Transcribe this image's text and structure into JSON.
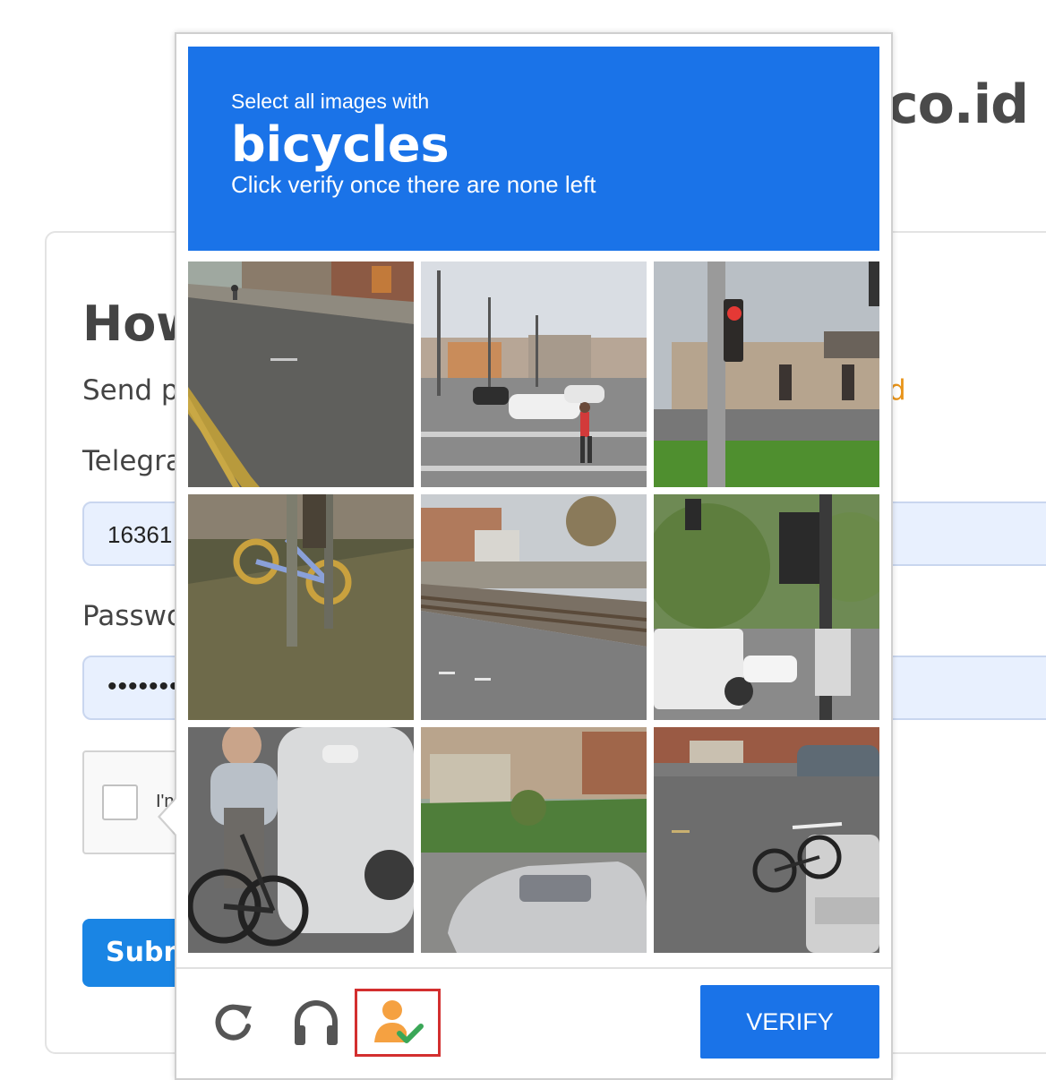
{
  "background_page": {
    "site_title": "co.id",
    "heading": "How",
    "description": "Send pr",
    "orange_text": "d",
    "telegram_label": "Telegra",
    "telegram_value": "16361",
    "password_label": "Passwo",
    "password_value": "••••••••",
    "recaptcha_text": "I'n",
    "submit_label": "Subm"
  },
  "challenge": {
    "instruction_line1": "Select all images with",
    "target": "bicycles",
    "instruction_line3": "Click verify once there are none left",
    "tiles": [
      {
        "content": "street with distant cyclist"
      },
      {
        "content": "intersection with pedestrian and white car"
      },
      {
        "content": "traffic light and building"
      },
      {
        "content": "bicycle near pole"
      },
      {
        "content": "railroad tracks and road"
      },
      {
        "content": "truck at traffic signal"
      },
      {
        "content": "cyclist beside white car"
      },
      {
        "content": "silver car by building"
      },
      {
        "content": "bicycles on truck rack"
      }
    ],
    "verify_label": "VERIFY",
    "accent_color": "#1a73e8"
  }
}
